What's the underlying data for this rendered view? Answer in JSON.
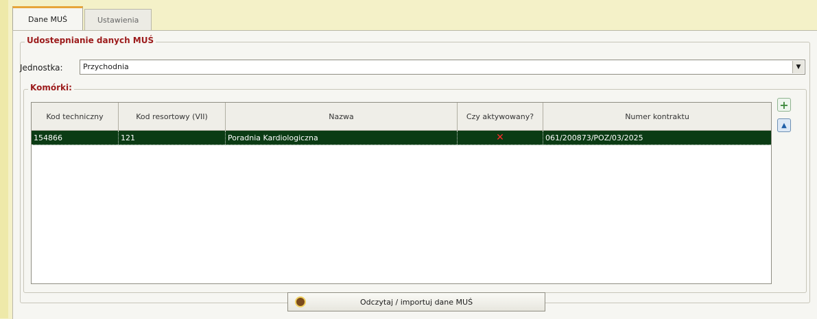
{
  "tabs": [
    {
      "label": "Dane MUŚ",
      "active": true
    },
    {
      "label": "Ustawienia",
      "active": false
    }
  ],
  "group": {
    "title": "Udostepnianie danych MUŚ",
    "unit_label": "Jednostka:",
    "unit_value": "Przychodnia"
  },
  "cells": {
    "title": "Komórki:",
    "columns": [
      "Kod techniczny",
      "Kod resortowy (VII)",
      "Nazwa",
      "Czy aktywowany?",
      "Numer kontraktu"
    ],
    "rows": [
      {
        "kod_techniczny": "154866",
        "kod_resortowy": "121",
        "nazwa": "Poradnia Kardiologiczna",
        "aktywowany": "✕",
        "numer_kontraktu": "061/200873/POZ/03/2025"
      }
    ]
  },
  "buttons": {
    "add_icon": "plus-icon",
    "up_icon": "up-arrow-icon",
    "import_label": "Odczytaj / importuj dane MUŚ"
  },
  "colors": {
    "selected_row": "#0b3b14",
    "section_title": "#9c1b1b",
    "inactive_mark": "#ff2a2a"
  }
}
